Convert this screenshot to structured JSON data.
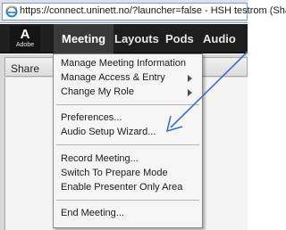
{
  "browser": {
    "url": "https://connect.uninett.no/?launcher=false - HSH testrom (Sha"
  },
  "app": {
    "logo_letter": "A",
    "logo_text": "Adobe",
    "menus": [
      "Meeting",
      "Layouts",
      "Pods",
      "Audio"
    ]
  },
  "panel": {
    "title": "Share"
  },
  "dropdown": {
    "items": [
      "Manage Meeting Information",
      "Manage Access & Entry",
      "Change My Role",
      "Preferences...",
      "Audio Setup Wizard...",
      "Record Meeting...",
      "Switch To Prepare Mode",
      "Enable Presenter Only Area",
      "End Meeting..."
    ]
  },
  "colors": {
    "annotation_arrow": "#3b6ec8",
    "appbar": "#1e1e1e"
  }
}
